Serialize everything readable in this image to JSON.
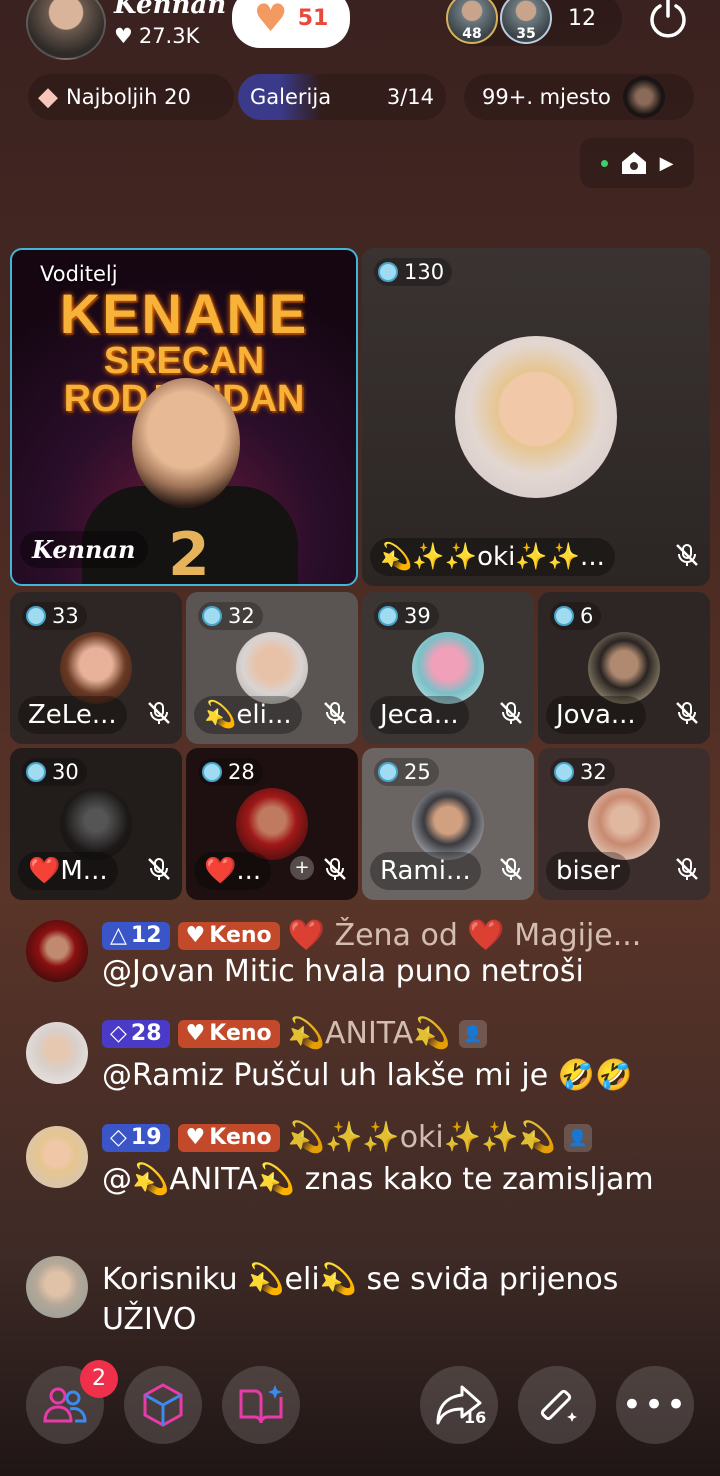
{
  "top": {
    "host_name": "Kennan",
    "host_likes": "27.3K",
    "heart_count": "51",
    "viewer_badges": [
      "48",
      "35"
    ],
    "viewer_count": "12"
  },
  "pills": {
    "ranking": "Najboljih 20",
    "gallery_label": "Galerija",
    "gallery_count": "3/14",
    "place": "99+. mjesto"
  },
  "host_seat": {
    "badge": "Voditelj",
    "poster_line1": "KENANE",
    "poster_line2": "SRECAN RODJENDAN",
    "poster_number": "2",
    "name": "Kennan"
  },
  "big_seat": {
    "count": "130",
    "name": "💫✨✨oki✨✨..."
  },
  "seats": [
    {
      "count": "33",
      "name": "ZeLe..."
    },
    {
      "count": "32",
      "name": "💫eli..."
    },
    {
      "count": "39",
      "name": "Jeca..."
    },
    {
      "count": "6",
      "name": "Jova..."
    },
    {
      "count": "30",
      "name": "❤️M..."
    },
    {
      "count": "28",
      "name": "❤️..."
    },
    {
      "count": "25",
      "name": "Rami..."
    },
    {
      "count": "32",
      "name": "biser"
    }
  ],
  "chat": [
    {
      "level": "12",
      "fan": "Keno",
      "user": "❤️ Žena od ❤️ Magije...",
      "text": "@Jovan Mitic hvala puno netroši"
    },
    {
      "level": "28",
      "fan": "Keno",
      "user": "💫ANITA💫",
      "text": "@Ramiz Puščul uh lakše mi je 🤣🤣"
    },
    {
      "level": "19",
      "fan": "Keno",
      "user": "💫✨✨oki✨✨💫",
      "text": "@💫ANITA💫 znas kako te zamisljam"
    },
    {
      "text": "Korisniku 💫eli💫 se sviđa prijenos UŽIVO"
    }
  ],
  "bottom": {
    "notif_badge": "2",
    "share_count": "16"
  },
  "colors": {
    "accent_border": "#41b6d6",
    "level_badge": "#3a55c8",
    "fan_badge": "#c24a2a",
    "notif": "#f0304a"
  }
}
